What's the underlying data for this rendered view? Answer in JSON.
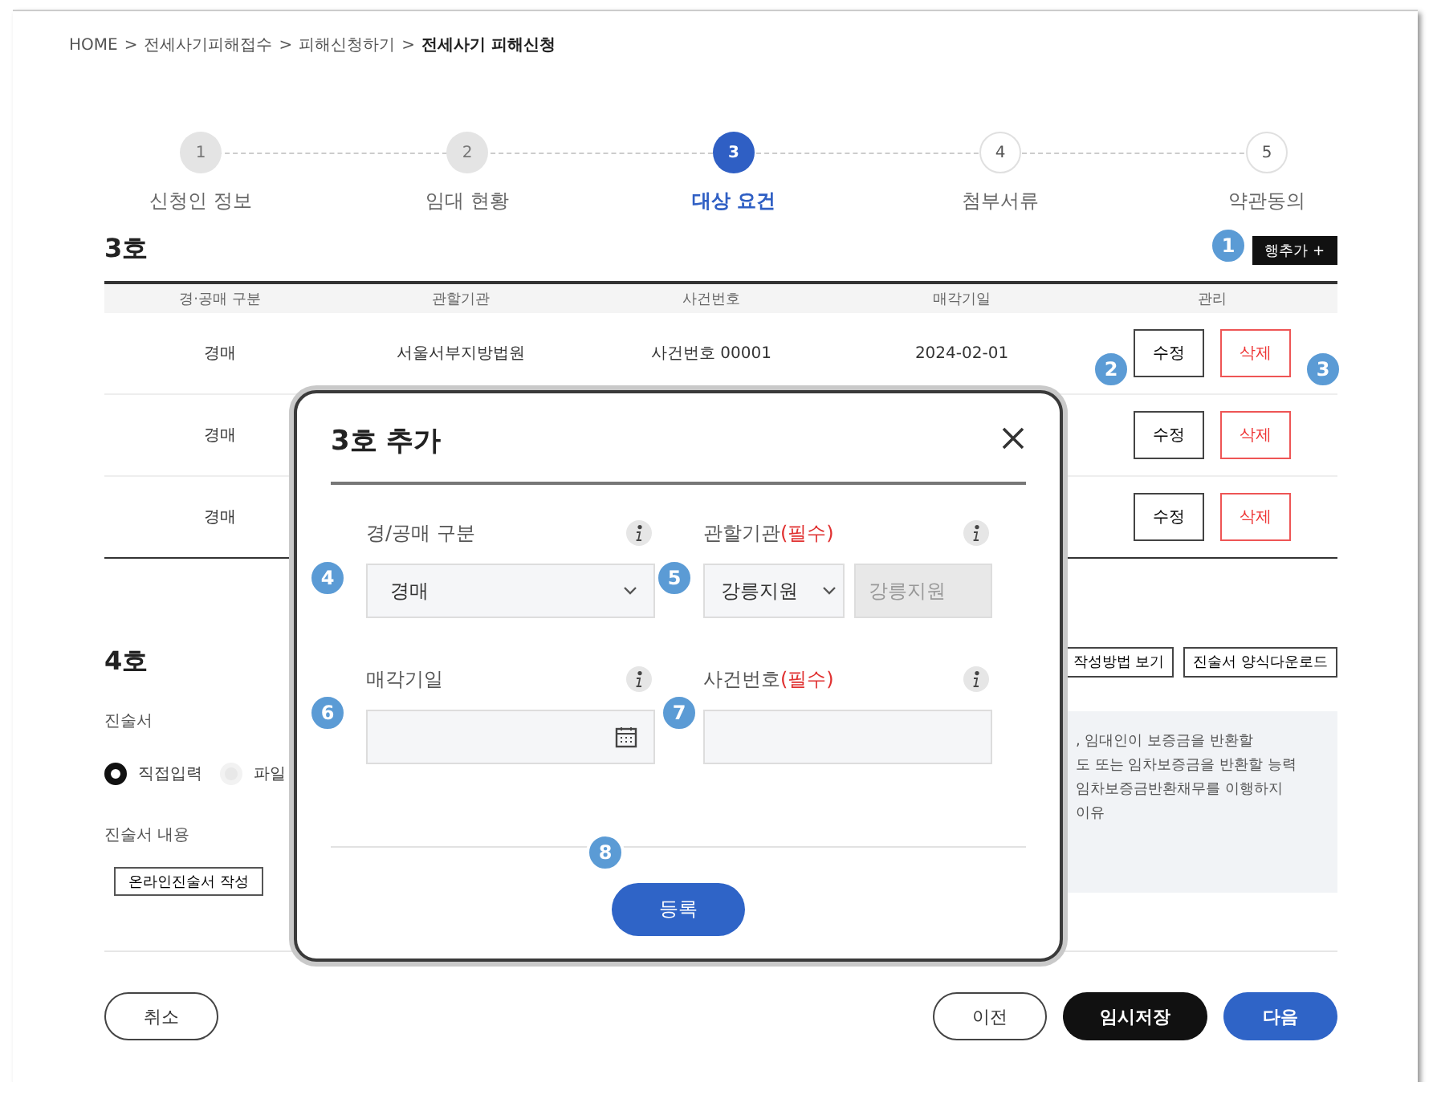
{
  "breadcrumb": [
    {
      "label": "HOME",
      "sep": ">",
      "current": false
    },
    {
      "label": "전세사기피해접수",
      "sep": ">",
      "current": false
    },
    {
      "label": "피해신청하기",
      "sep": ">",
      "current": false
    },
    {
      "label": "전세사기 피해신청",
      "current": true
    }
  ],
  "steps": [
    {
      "number": "1",
      "label": "신청인 정보",
      "completed": true,
      "selected": false
    },
    {
      "number": "2",
      "label": "임대 현황",
      "completed": true,
      "selected": false
    },
    {
      "number": "3",
      "label": "대상 요건",
      "completed": false,
      "selected": true
    },
    {
      "number": "4",
      "label": "첨부서류",
      "completed": false,
      "selected": false
    },
    {
      "number": "5",
      "label": "약관동의",
      "completed": false,
      "selected": false
    }
  ],
  "section_3": {
    "title": "3호",
    "add_button": "행추가 +",
    "table": {
      "columns": [
        "경·공매 구분",
        "관할기관",
        "사건번호",
        "매각기일",
        "관리"
      ],
      "rows": [
        {
          "cells": [
            "경매",
            "서울서부지방법원",
            "사건번호 00001",
            "2024-02-01"
          ],
          "edit": "수정",
          "delete": "삭제"
        },
        {
          "cells": [
            "경매"
          ],
          "edit": "수정",
          "delete": "삭제"
        },
        {
          "cells": [
            "경매"
          ],
          "edit": "수정",
          "delete": "삭제"
        }
      ]
    }
  },
  "section_4": {
    "title": "4호",
    "buttons": [
      "작성방법 보기",
      "진술서 양식다운로드"
    ],
    "statement_label": "진술서",
    "radios": [
      {
        "label": "직접입력",
        "selected": true
      },
      {
        "label": "파일",
        "selected": false
      }
    ],
    "content_label": "진술서 내용",
    "write_button": "온라인진술서 작성",
    "notice_lines": [
      ", 임대인이 보증금을 반환할",
      "도 또는 임차보증금을 반환할 능력",
      "임차보증금반환채무를 이행하지",
      "이유"
    ]
  },
  "modal": {
    "title": "3호 추가",
    "fields": [
      {
        "kind": "select",
        "label": "경/공매 구분",
        "info": true,
        "value": "경매"
      },
      {
        "kind": "select_pair",
        "label": "관할기관",
        "required_note": "(필수)",
        "info": true,
        "value": "강릉지원",
        "readonly_value": "강릉지원"
      },
      {
        "kind": "date",
        "label": "매각기일",
        "info": true
      },
      {
        "kind": "text",
        "label": "사건번호",
        "required_note": "(필수)",
        "info": true
      }
    ],
    "submit": "등록"
  },
  "footer": {
    "cancel": "취소",
    "prev": "이전",
    "save": "임시저장",
    "next": "다음"
  },
  "markers": [
    "1",
    "2",
    "3",
    "4",
    "5",
    "6",
    "7",
    "8"
  ]
}
